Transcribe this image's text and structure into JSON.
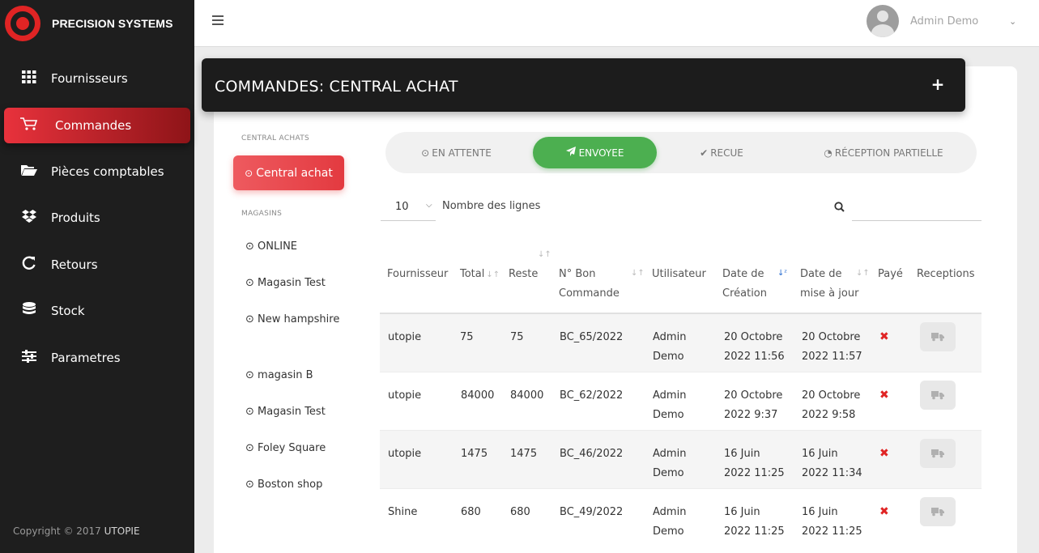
{
  "brand": {
    "name": "PRECISION SYSTEMS"
  },
  "sidebar": {
    "items": [
      {
        "label": "Fournisseurs",
        "icon": "grid-icon"
      },
      {
        "label": "Commandes",
        "icon": "cart-icon",
        "active": true
      },
      {
        "label": "Pièces comptables",
        "icon": "folder-open-icon"
      },
      {
        "label": "Produits",
        "icon": "dropbox-icon"
      },
      {
        "label": "Retours",
        "icon": "refresh-icon"
      },
      {
        "label": "Stock",
        "icon": "database-icon"
      },
      {
        "label": "Parametres",
        "icon": "sliders-icon"
      }
    ],
    "copyright_prefix": "Copyright © 2017",
    "copyright_brand": "UTOPIE"
  },
  "topbar": {
    "user_name": "Admin Demo"
  },
  "page": {
    "title": "COMMANDES: CENTRAL ACHAT",
    "add_icon": "plus-icon"
  },
  "left_panel": {
    "central_label": "CENTRAL ACHATS",
    "central_button": "Central achat",
    "stores_label": "MAGASINS",
    "stores": [
      "ONLINE",
      "Magasin Test",
      "New hampshire",
      "magasin B",
      "Magasin Test",
      "Foley Square",
      "Boston shop"
    ]
  },
  "tabs": [
    {
      "label": "EN ATTENTE",
      "icon": "clock-icon"
    },
    {
      "label": "ENVOYEE",
      "icon": "paper-plane-icon",
      "active": true
    },
    {
      "label": "RECUE",
      "icon": "check-icon"
    },
    {
      "label": "RÉCEPTION PARTIELLE",
      "icon": "pie-chart-icon"
    }
  ],
  "table_controls": {
    "rows_value": "10",
    "rows_label": "Nombre des lignes",
    "search_value": ""
  },
  "table": {
    "headers": {
      "fournisseur": "Fournisseur",
      "total": "Total",
      "reste": "Reste",
      "bon_commande": "N° Bon Commande",
      "utilisateur": "Utilisateur",
      "date_creation": "Date de Création",
      "date_maj": "Date de mise à jour",
      "paye": "Payé",
      "receptions": "Receptions"
    },
    "rows": [
      {
        "fournisseur": "utopie",
        "total": "75",
        "reste": "75",
        "bon": "BC_65/2022",
        "user1": "Admin",
        "user2": "Demo",
        "created1": "20 Octobre",
        "created2": "2022 11:56",
        "updated1": "20 Octobre",
        "updated2": "2022 11:57"
      },
      {
        "fournisseur": "utopie",
        "total": "84000",
        "reste": "84000",
        "bon": "BC_62/2022",
        "user1": "Admin",
        "user2": "Demo",
        "created1": "20 Octobre",
        "created2": "2022 9:37",
        "updated1": "20 Octobre",
        "updated2": "2022 9:58"
      },
      {
        "fournisseur": "utopie",
        "total": "1475",
        "reste": "1475",
        "bon": "BC_46/2022",
        "user1": "Admin",
        "user2": "Demo",
        "created1": "16 Juin",
        "created2": "2022 11:25",
        "updated1": "16 Juin",
        "updated2": "2022 11:34"
      },
      {
        "fournisseur": "Shine",
        "total": "680",
        "reste": "680",
        "bon": "BC_49/2022",
        "user1": "Admin",
        "user2": "Demo",
        "created1": "16 Juin",
        "created2": "2022 11:25",
        "updated1": "16 Juin",
        "updated2": "2022 11:25"
      }
    ]
  },
  "colors": {
    "accent_red": "#e33a40",
    "active_green": "#4caf50",
    "sidebar_bg": "#1e1e1e"
  }
}
